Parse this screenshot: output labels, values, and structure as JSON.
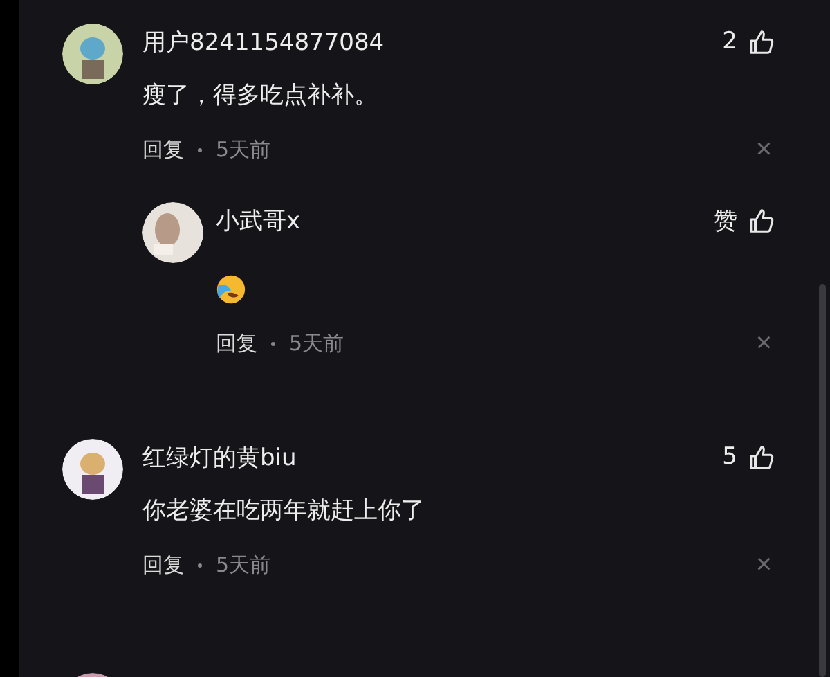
{
  "comments": [
    {
      "user": "用户8241154877084",
      "kind": "text",
      "text": "瘦了，得多吃点补补。",
      "likes": "2",
      "reply_label": "回复",
      "time": "5天前",
      "close": "×",
      "replies": [
        {
          "user": "小武哥x",
          "kind": "emoji",
          "likes": "赞",
          "reply_label": "回复",
          "time": "5天前",
          "close": "×"
        }
      ]
    },
    {
      "user": "红绿灯的黄biu",
      "kind": "text",
      "text": "你老婆在吃两年就赶上你了",
      "likes": "5",
      "reply_label": "回复",
      "time": "5天前",
      "close": "×"
    }
  ]
}
